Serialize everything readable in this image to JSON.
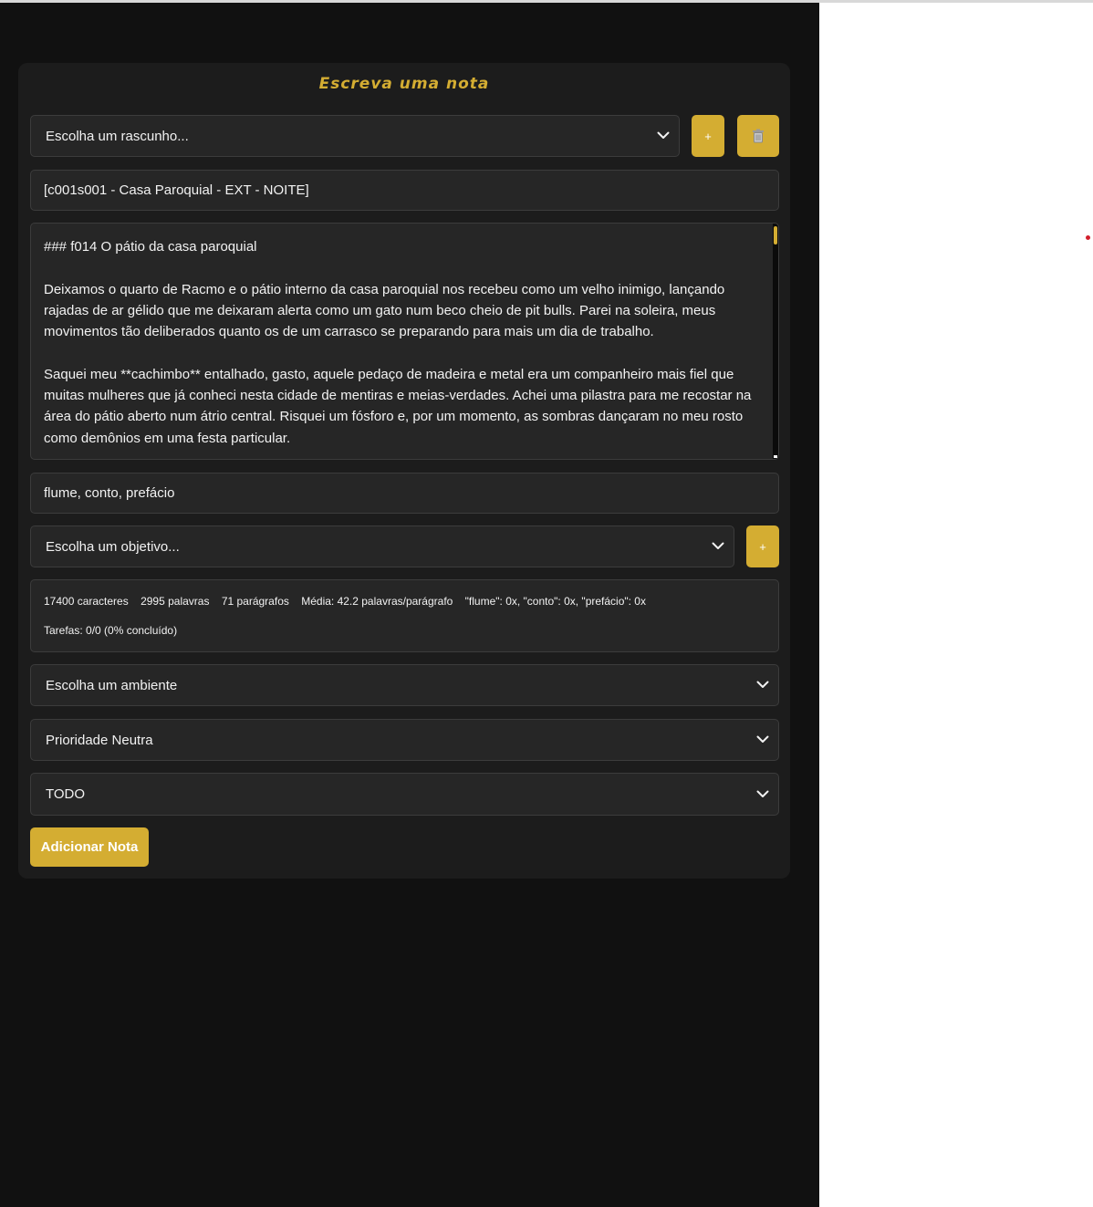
{
  "form": {
    "title": "Escreva uma nota",
    "draft_select": {
      "value": "Escolha um rascunho..."
    },
    "draft_add_label": "+",
    "draft_delete_icon": "trash-icon",
    "note_title": "[c001s001 - Casa Paroquial - EXT - NOITE]",
    "body": {
      "heading": "### f014 O pátio da casa paroquial",
      "paragraphs": [
        "Deixamos o quarto de Racmo e o pátio interno da casa paroquial nos recebeu como um velho inimigo, lançando rajadas de ar gélido que me deixaram alerta como um gato num beco cheio de pit bulls. Parei na soleira, meus movimentos tão deliberados quanto os de um carrasco se preparando para mais um dia de trabalho.",
        "Saquei meu **cachimbo** entalhado, gasto, aquele pedaço de madeira e metal era um companheiro mais fiel que muitas mulheres que já conheci nesta cidade de mentiras e meias-verdades. Achei uma pilastra para me recostar na área do pátio aberto num átrio central. Risquei um fósforo e, por um momento, as sombras dançaram no meu rosto como demônios em uma festa particular."
      ]
    },
    "tags": "flume, conto, prefácio",
    "goal_select": {
      "value": "Escolha um objetivo..."
    },
    "goal_add_label": "+",
    "stats": {
      "characters": "17400 caracteres",
      "words": "2995 palavras",
      "paragraphs": "71 parágrafos",
      "average": "Média: 42.2 palavras/parágrafo",
      "tag_counts": "\"flume\": 0x, \"conto\": 0x, \"prefácio\": 0x",
      "tasks": "Tarefas: 0/0 (0% concluído)"
    },
    "env_select": {
      "value": "Escolha um ambiente"
    },
    "priority_select": {
      "value": "Prioridade Neutra"
    },
    "status_select": {
      "value": "TODO"
    },
    "submit_label": "Adicionar Nota"
  },
  "colors": {
    "accent": "#d4ad32",
    "page_background": "#111111",
    "card_background": "#1c1c1c",
    "field_background": "#262626",
    "text": "#f2f2f2"
  }
}
